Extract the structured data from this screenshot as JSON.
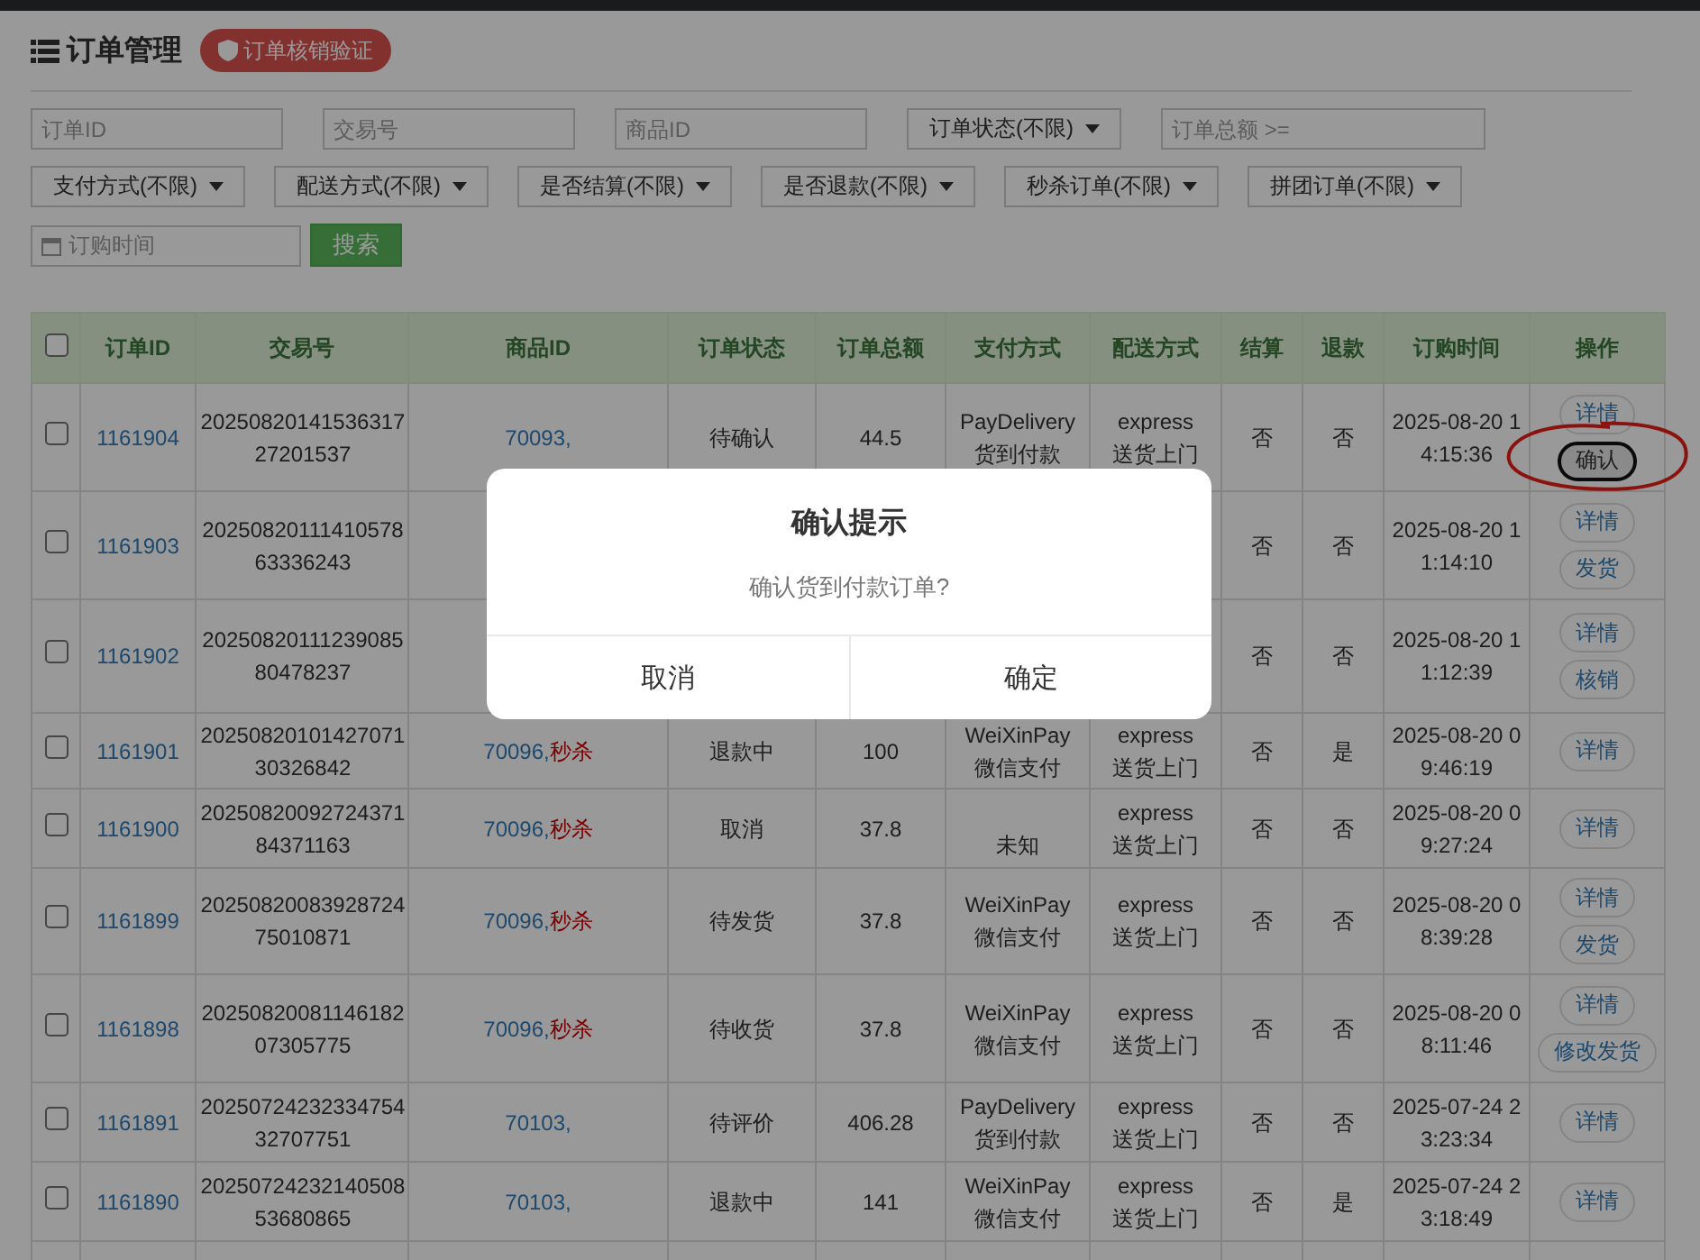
{
  "page": {
    "title": "订单管理",
    "verify_button": "订单核销验证"
  },
  "filters": {
    "row_1": [
      {
        "kind": "input",
        "placeholder": "订单ID"
      },
      {
        "kind": "input",
        "placeholder": "交易号"
      },
      {
        "kind": "input",
        "placeholder": "商品ID"
      },
      {
        "kind": "select",
        "label": "订单状态(不限)"
      },
      {
        "kind": "input",
        "placeholder": "订单总额 >="
      }
    ],
    "row_2": [
      "支付方式(不限)",
      "配送方式(不限)",
      "是否结算(不限)",
      "是否退款(不限)",
      "秒杀订单(不限)",
      "拼团订单(不限)"
    ],
    "date": {
      "placeholder": "订购时间"
    },
    "search_button": "搜索"
  },
  "table": {
    "select_all": {
      "checked": false
    },
    "columns": [
      "订单ID",
      "交易号",
      "商品ID",
      "订单状态",
      "订单总额",
      "支付方式",
      "配送方式",
      "结算",
      "退款",
      "订购时间",
      "操作"
    ],
    "rows": [
      {
        "checked": false,
        "id": "1161904",
        "trade_no": "2025082014153631727201537",
        "goods": "70093,",
        "status": "待确认",
        "total": "44.5",
        "pay_code": "PayDelivery",
        "pay_name": "货到付款",
        "delivery_code": "express",
        "delivery_name": "送货上门",
        "settled": "否",
        "refunded": "否",
        "time": "2025-08-20 14:15:36",
        "actions": [
          {
            "label": "详情",
            "focused": false
          },
          {
            "label": "确认",
            "focused": true
          }
        ]
      },
      {
        "checked": false,
        "id": "1161903",
        "trade_no": "2025082011141057863336243",
        "settled": "否",
        "refunded": "否",
        "time": "2025-08-20 11:14:10",
        "actions": [
          {
            "label": "详情",
            "focused": false
          },
          {
            "label": "发货",
            "focused": false
          }
        ]
      },
      {
        "checked": false,
        "id": "1161902",
        "trade_no": "2025082011123908580478237",
        "settled": "否",
        "refunded": "否",
        "time": "2025-08-20 11:12:39",
        "actions": [
          {
            "label": "详情",
            "focused": false
          },
          {
            "label": "核销",
            "focused": false
          }
        ]
      },
      {
        "checked": false,
        "id": "1161901",
        "trade_no": "2025082010142707130326842",
        "goods": "70096,",
        "goods_tag": "秒杀",
        "status": "退款中",
        "total": "100",
        "pay_code": "WeiXinPay",
        "pay_name": "微信支付",
        "delivery_code": "express",
        "delivery_name": "送货上门",
        "settled": "否",
        "refunded": "是",
        "time": "2025-08-20 09:46:19",
        "actions": [
          {
            "label": "详情",
            "focused": false
          }
        ]
      },
      {
        "checked": false,
        "id": "1161900",
        "trade_no": "2025082009272437184371163",
        "goods": "70096,",
        "goods_tag": "秒杀",
        "status": "取消",
        "total": "37.8",
        "pay_name": "未知",
        "delivery_code": "express",
        "delivery_name": "送货上门",
        "settled": "否",
        "refunded": "否",
        "time": "2025-08-20 09:27:24",
        "actions": [
          {
            "label": "详情",
            "focused": false
          }
        ]
      },
      {
        "checked": false,
        "id": "1161899",
        "trade_no": "2025082008392872475010871",
        "goods": "70096,",
        "goods_tag": "秒杀",
        "status": "待发货",
        "total": "37.8",
        "pay_code": "WeiXinPay",
        "pay_name": "微信支付",
        "delivery_code": "express",
        "delivery_name": "送货上门",
        "settled": "否",
        "refunded": "否",
        "time": "2025-08-20 08:39:28",
        "actions": [
          {
            "label": "详情",
            "focused": false
          },
          {
            "label": "发货",
            "focused": false
          }
        ]
      },
      {
        "checked": false,
        "id": "1161898",
        "trade_no": "2025082008114618207305775",
        "goods": "70096,",
        "goods_tag": "秒杀",
        "status": "待收货",
        "total": "37.8",
        "pay_code": "WeiXinPay",
        "pay_name": "微信支付",
        "delivery_code": "express",
        "delivery_name": "送货上门",
        "settled": "否",
        "refunded": "否",
        "time": "2025-08-20 08:11:46",
        "actions": [
          {
            "label": "详情",
            "focused": false
          },
          {
            "label": "修改发货",
            "focused": false
          }
        ]
      },
      {
        "checked": false,
        "id": "1161891",
        "trade_no": "2025072423233475432707751",
        "goods": "70103,",
        "status": "待评价",
        "total": "406.28",
        "pay_code": "PayDelivery",
        "pay_name": "货到付款",
        "delivery_code": "express",
        "delivery_name": "送货上门",
        "settled": "否",
        "refunded": "否",
        "time": "2025-07-24 23:23:34",
        "actions": [
          {
            "label": "详情",
            "focused": false
          }
        ]
      },
      {
        "checked": false,
        "id": "1161890",
        "trade_no": "2025072423214050853680865",
        "goods": "70103,",
        "status": "退款中",
        "total": "141",
        "pay_code": "WeiXinPay",
        "pay_name": "微信支付",
        "delivery_code": "express",
        "delivery_name": "送货上门",
        "settled": "否",
        "refunded": "是",
        "time": "2025-07-24 23:18:49",
        "actions": [
          {
            "label": "详情",
            "focused": false
          }
        ]
      }
    ]
  },
  "dialog": {
    "title": "确认提示",
    "message": "确认货到付款订单?",
    "buttons": [
      "取消",
      "确定"
    ]
  }
}
